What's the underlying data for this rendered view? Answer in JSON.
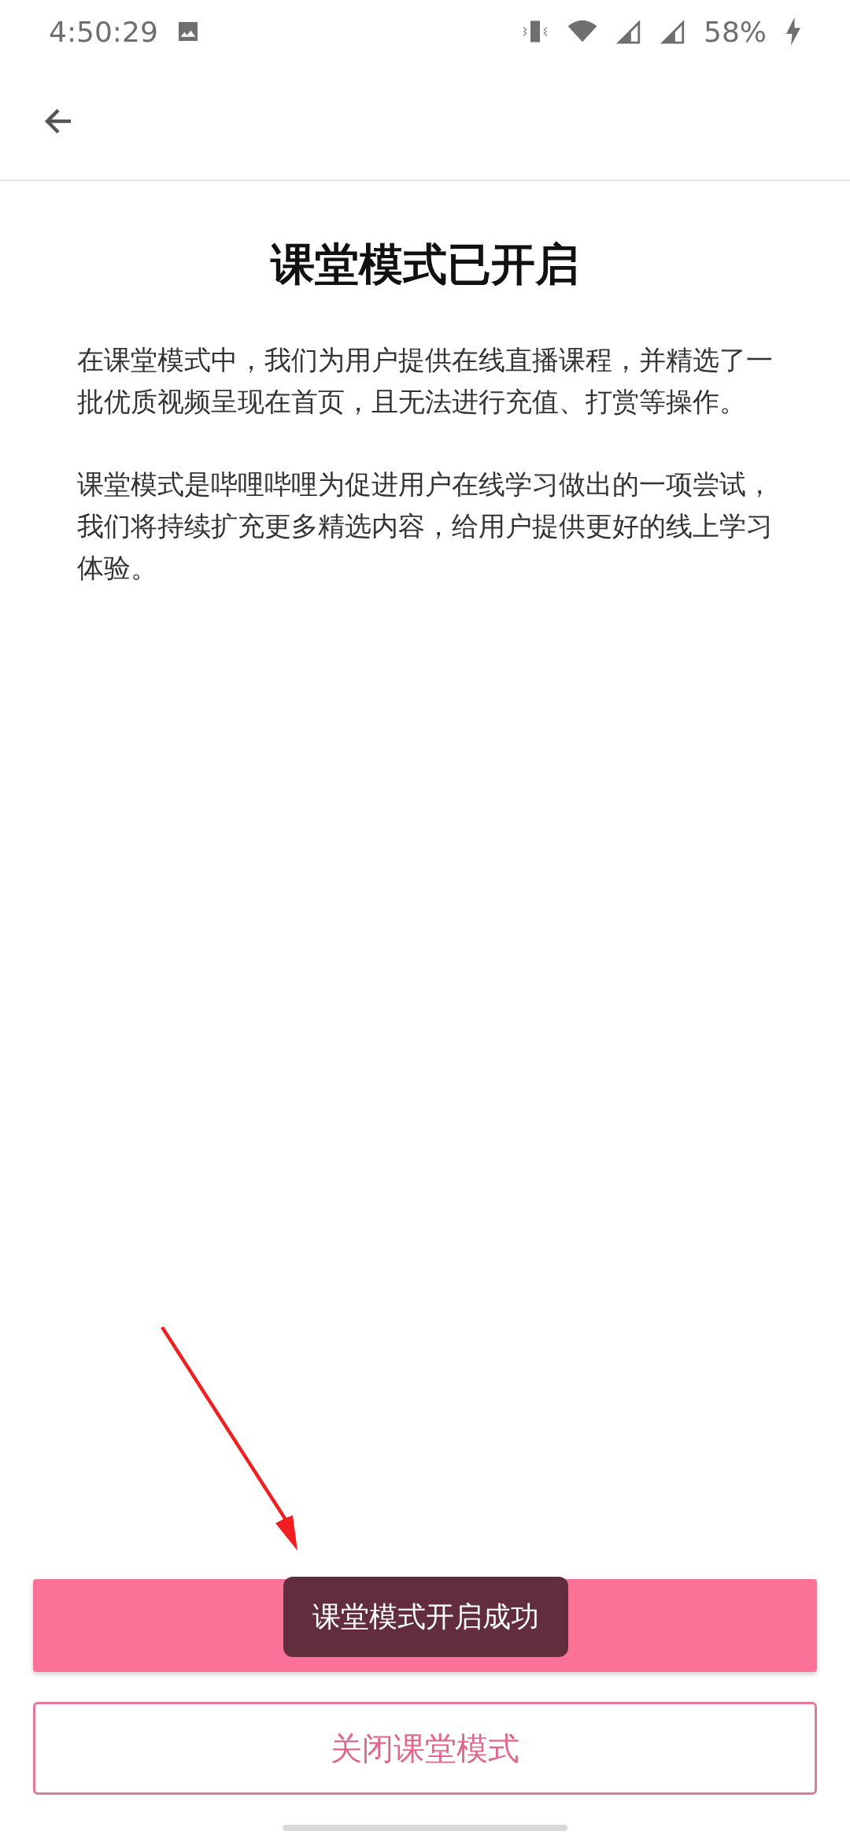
{
  "status_bar": {
    "time": "4:50:29",
    "battery": "58%"
  },
  "title": "课堂模式已开启",
  "paragraphs": [
    "在课堂模式中，我们为用户提供在线直播课程，并精选了一批优质视频呈现在首页，且无法进行充值、打赏等操作。",
    "课堂模式是哔哩哔哩为促进用户在线学习做出的一项尝试，我们将持续扩充更多精选内容，给用户提供更好的线上学习体验。"
  ],
  "buttons": [
    {
      "kind": "filled"
    },
    {
      "kind": "outlined",
      "label": "关闭课堂模式"
    }
  ],
  "toast": "课堂模式开启成功"
}
